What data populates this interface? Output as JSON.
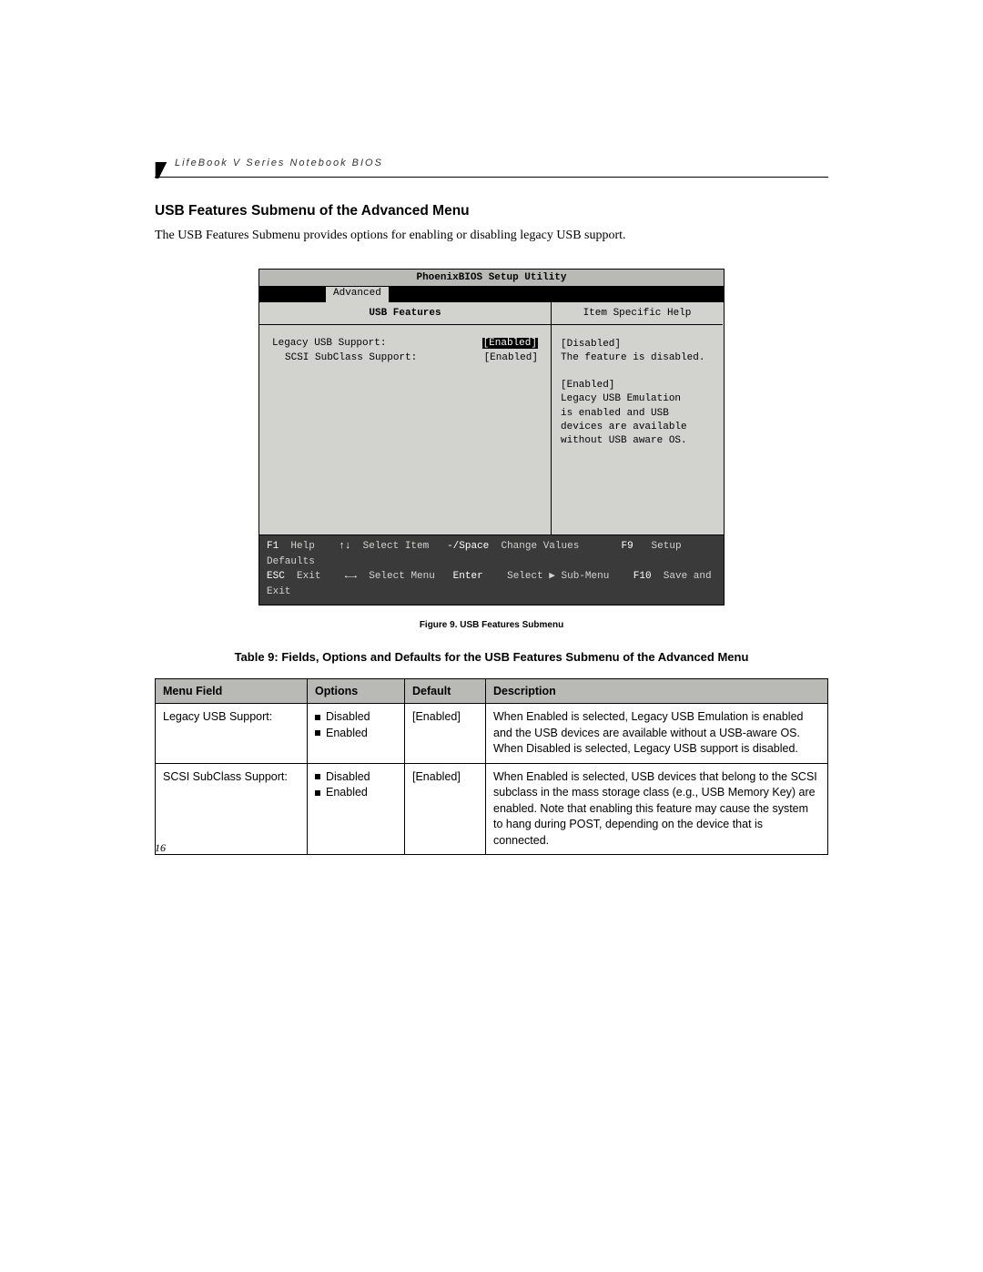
{
  "header": "LifeBook V Series Notebook BIOS",
  "section_title": "USB Features Submenu of the Advanced Menu",
  "intro": "The USB Features Submenu provides options for enabling or disabling legacy USB support.",
  "bios": {
    "title": "PhoenixBIOS Setup Utility",
    "tab_active": "Advanced",
    "subtitle": "USB Features",
    "help_title": "Item Specific Help",
    "rows": [
      {
        "label": "Legacy USB Support:",
        "value": "[Enabled]",
        "selected": true
      },
      {
        "label": "SCSI SubClass Support:",
        "value": "[Enabled]",
        "selected": false,
        "indent": true
      }
    ],
    "help": {
      "d_head": "[Disabled]",
      "d_body": "The feature is disabled.",
      "e_head": "[Enabled]",
      "e_l1": "Legacy USB Emulation",
      "e_l2": "is enabled and USB",
      "e_l3": "devices are available",
      "e_l4": "without USB aware OS."
    },
    "footer": {
      "f1": "F1",
      "help": "Help",
      "arrows_ud": "↑↓",
      "select_item": "Select Item",
      "minus_space": "-/Space",
      "change_values": "Change Values",
      "f9": "F9",
      "setup_defaults": "Setup Defaults",
      "esc": "ESC",
      "exit": "Exit",
      "arrows_lr": "←→",
      "select_menu": "Select Menu",
      "enter": "Enter",
      "select_sub": "Select ▶ Sub-Menu",
      "f10": "F10",
      "save_exit": "Save and Exit"
    }
  },
  "figure_caption": "Figure 9.  USB Features Submenu",
  "table_caption": "Table 9: Fields, Options and Defaults for the USB Features Submenu of the Advanced Menu",
  "table": {
    "headers": [
      "Menu Field",
      "Options",
      "Default",
      "Description"
    ],
    "rows": [
      {
        "field": "Legacy USB Support:",
        "options": [
          "Disabled",
          "Enabled"
        ],
        "default": "[Enabled]",
        "description": "When Enabled is selected, Legacy USB Emulation is enabled and the USB devices are available without a USB-aware OS. When Disabled is selected, Legacy USB support is disabled."
      },
      {
        "field": "SCSI SubClass Support:",
        "options": [
          "Disabled",
          "Enabled"
        ],
        "default": "[Enabled]",
        "description": "When Enabled is selected, USB devices that belong to the SCSI subclass in the mass storage class (e.g., USB Memory Key) are enabled. Note that enabling this feature may cause the system to hang during POST, depending on the device that is connected."
      }
    ]
  },
  "page_number": "16"
}
